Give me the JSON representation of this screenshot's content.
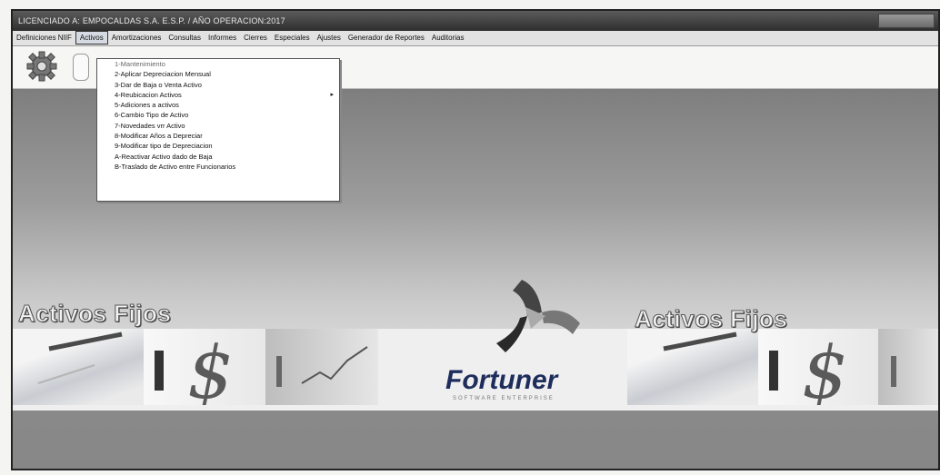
{
  "window": {
    "title": "LICENCIADO A: EMPOCALDAS S.A. E.S.P. / AÑO OPERACION:2017"
  },
  "menubar": {
    "items": [
      {
        "label": "Definiciones NIIF"
      },
      {
        "label": "Activos"
      },
      {
        "label": "Amortizaciones"
      },
      {
        "label": "Consultas"
      },
      {
        "label": "Informes"
      },
      {
        "label": "Cierres"
      },
      {
        "label": "Especiales"
      },
      {
        "label": "Ajustes"
      },
      {
        "label": "Generador de Reportes"
      },
      {
        "label": "Auditorias"
      }
    ],
    "active_index": 1
  },
  "toolbar": {
    "icons": [
      "gear-icon"
    ]
  },
  "dropdown": {
    "items": [
      {
        "label": "1-Mantenimiento",
        "submenu": false
      },
      {
        "label": "2-Aplicar Depreciacion Mensual",
        "submenu": false
      },
      {
        "label": "3-Dar de Baja o Venta Activo",
        "submenu": false
      },
      {
        "label": "4-Reubicacion Activos",
        "submenu": true
      },
      {
        "label": "5-Adiciones a activos",
        "submenu": false
      },
      {
        "label": "6-Cambio Tipo de Activo",
        "submenu": false
      },
      {
        "label": "7-Novedades vrr Activo",
        "submenu": false
      },
      {
        "label": "8-Modificar Años a Depreciar",
        "submenu": false
      },
      {
        "label": "9-Modificar tipo de Depreciacion",
        "submenu": false
      },
      {
        "label": "A-Reactivar Activo dado de Baja",
        "submenu": false
      },
      {
        "label": "B-Traslado de Activo entre Funcionarios",
        "submenu": false
      }
    ]
  },
  "banner": {
    "left_label": "Activos Fijos",
    "right_label": "Activos Fijos",
    "logo_name": "Fortuner",
    "logo_tagline": "SOFTWARE ENTERPRISE"
  },
  "colors": {
    "logo_blue": "#1e2d5c",
    "logo_red": "#c0333b",
    "titlebar": "#3a3a3a"
  }
}
